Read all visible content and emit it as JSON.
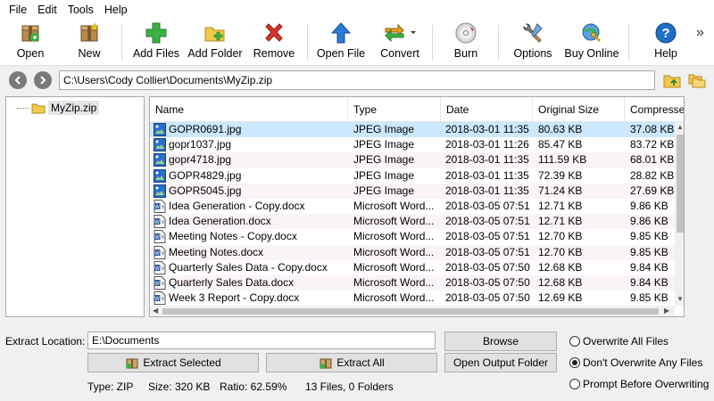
{
  "menu": [
    "File",
    "Edit",
    "Tools",
    "Help"
  ],
  "toolbar": {
    "open": "Open",
    "new": "New",
    "add_files": "Add Files",
    "add_folder": "Add Folder",
    "remove": "Remove",
    "open_file": "Open File",
    "convert": "Convert",
    "burn": "Burn",
    "options": "Options",
    "buy_online": "Buy Online",
    "help": "Help",
    "overflow": "»"
  },
  "address": {
    "path": "C:\\Users\\Cody Collier\\Documents\\MyZip.zip"
  },
  "tree": {
    "root": "MyZip.zip"
  },
  "list": {
    "columns": [
      "Name",
      "Type",
      "Date",
      "Original Size",
      "Compressed"
    ],
    "rows": [
      {
        "name": "GOPR0691.jpg",
        "type": "JPEG Image",
        "date": "2018-03-01 11:35",
        "size": "80.63 KB",
        "comp": "37.08 KB",
        "icon": "jpeg-file-icon"
      },
      {
        "name": "gopr1037.jpg",
        "type": "JPEG Image",
        "date": "2018-03-01 11:26",
        "size": "85.47 KB",
        "comp": "83.72 KB",
        "icon": "jpeg-file-icon"
      },
      {
        "name": "gopr4718.jpg",
        "type": "JPEG Image",
        "date": "2018-03-01 11:35",
        "size": "111.59 KB",
        "comp": "68.01 KB",
        "icon": "jpeg-file-icon"
      },
      {
        "name": "GOPR4829.jpg",
        "type": "JPEG Image",
        "date": "2018-03-01 11:35",
        "size": "72.39 KB",
        "comp": "28.82 KB",
        "icon": "jpeg-file-icon"
      },
      {
        "name": "GOPR5045.jpg",
        "type": "JPEG Image",
        "date": "2018-03-01 11:35",
        "size": "71.24 KB",
        "comp": "27.69 KB",
        "icon": "jpeg-file-icon"
      },
      {
        "name": "Idea Generation - Copy.docx",
        "type": "Microsoft Word...",
        "date": "2018-03-05 07:51",
        "size": "12.71 KB",
        "comp": "9.86 KB",
        "icon": "word-file-icon"
      },
      {
        "name": "Idea Generation.docx",
        "type": "Microsoft Word...",
        "date": "2018-03-05 07:51",
        "size": "12.71 KB",
        "comp": "9.86 KB",
        "icon": "word-file-icon"
      },
      {
        "name": "Meeting Notes - Copy.docx",
        "type": "Microsoft Word...",
        "date": "2018-03-05 07:51",
        "size": "12.70 KB",
        "comp": "9.85 KB",
        "icon": "word-file-icon"
      },
      {
        "name": "Meeting Notes.docx",
        "type": "Microsoft Word...",
        "date": "2018-03-05 07:51",
        "size": "12.70 KB",
        "comp": "9.85 KB",
        "icon": "word-file-icon"
      },
      {
        "name": "Quarterly Sales Data - Copy.docx",
        "type": "Microsoft Word...",
        "date": "2018-03-05 07:50",
        "size": "12.68 KB",
        "comp": "9.84 KB",
        "icon": "word-file-icon"
      },
      {
        "name": "Quarterly Sales Data.docx",
        "type": "Microsoft Word...",
        "date": "2018-03-05 07:50",
        "size": "12.68 KB",
        "comp": "9.84 KB",
        "icon": "word-file-icon"
      },
      {
        "name": "Week 3 Report - Copy.docx",
        "type": "Microsoft Word...",
        "date": "2018-03-05 07:50",
        "size": "12.69 KB",
        "comp": "9.85 KB",
        "icon": "word-file-icon"
      }
    ]
  },
  "extract": {
    "label": "Extract Location:",
    "value": "E:\\Documents",
    "browse": "Browse",
    "open_output": "Open Output Folder",
    "extract_selected": "Extract Selected",
    "extract_all": "Extract All"
  },
  "options": {
    "overwrite_all": "Overwrite All Files",
    "dont_overwrite": "Don't Overwrite Any Files",
    "prompt": "Prompt Before Overwriting",
    "selected": "dont_overwrite"
  },
  "status": {
    "type": "Type: ZIP",
    "size": "Size: 320 KB",
    "ratio": "Ratio: 62.59%",
    "count": "13 Files, 0 Folders"
  },
  "colors": {
    "selection": "#cce8ff",
    "alt_row": "#fbf4f4",
    "green": "#3cb043",
    "red": "#d9342b",
    "blue": "#2a7bd6"
  }
}
